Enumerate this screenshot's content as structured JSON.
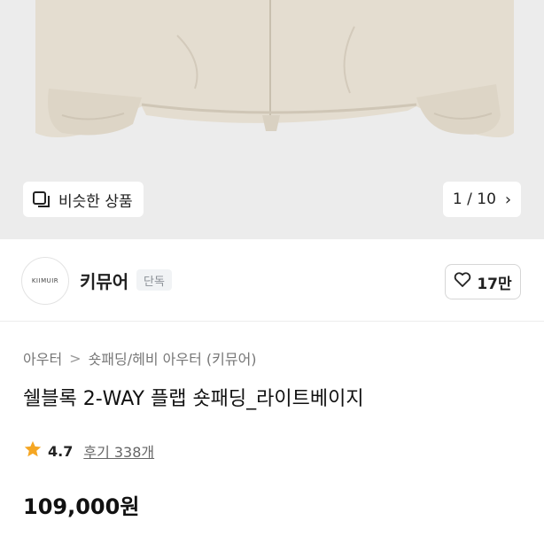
{
  "hero": {
    "similar_label": "비슷한 상품",
    "page_current": "1",
    "page_total": "10",
    "page_separator": "/"
  },
  "brand": {
    "logo_text": "KIIMUIR",
    "name": "키뮤어",
    "badge": "단독",
    "likes": "17만"
  },
  "breadcrumb": {
    "items": [
      "아우터",
      "숏패딩/헤비 아우터 (키뮤어)"
    ],
    "separator": ">"
  },
  "product": {
    "title": "쉘블록 2-WAY 플랩 숏패딩_라이트베이지",
    "rating": "4.7",
    "review_label": "후기 338개",
    "price": "109,000원"
  },
  "colors": {
    "star": "#f5a623",
    "jacket": "#e3dccf"
  }
}
